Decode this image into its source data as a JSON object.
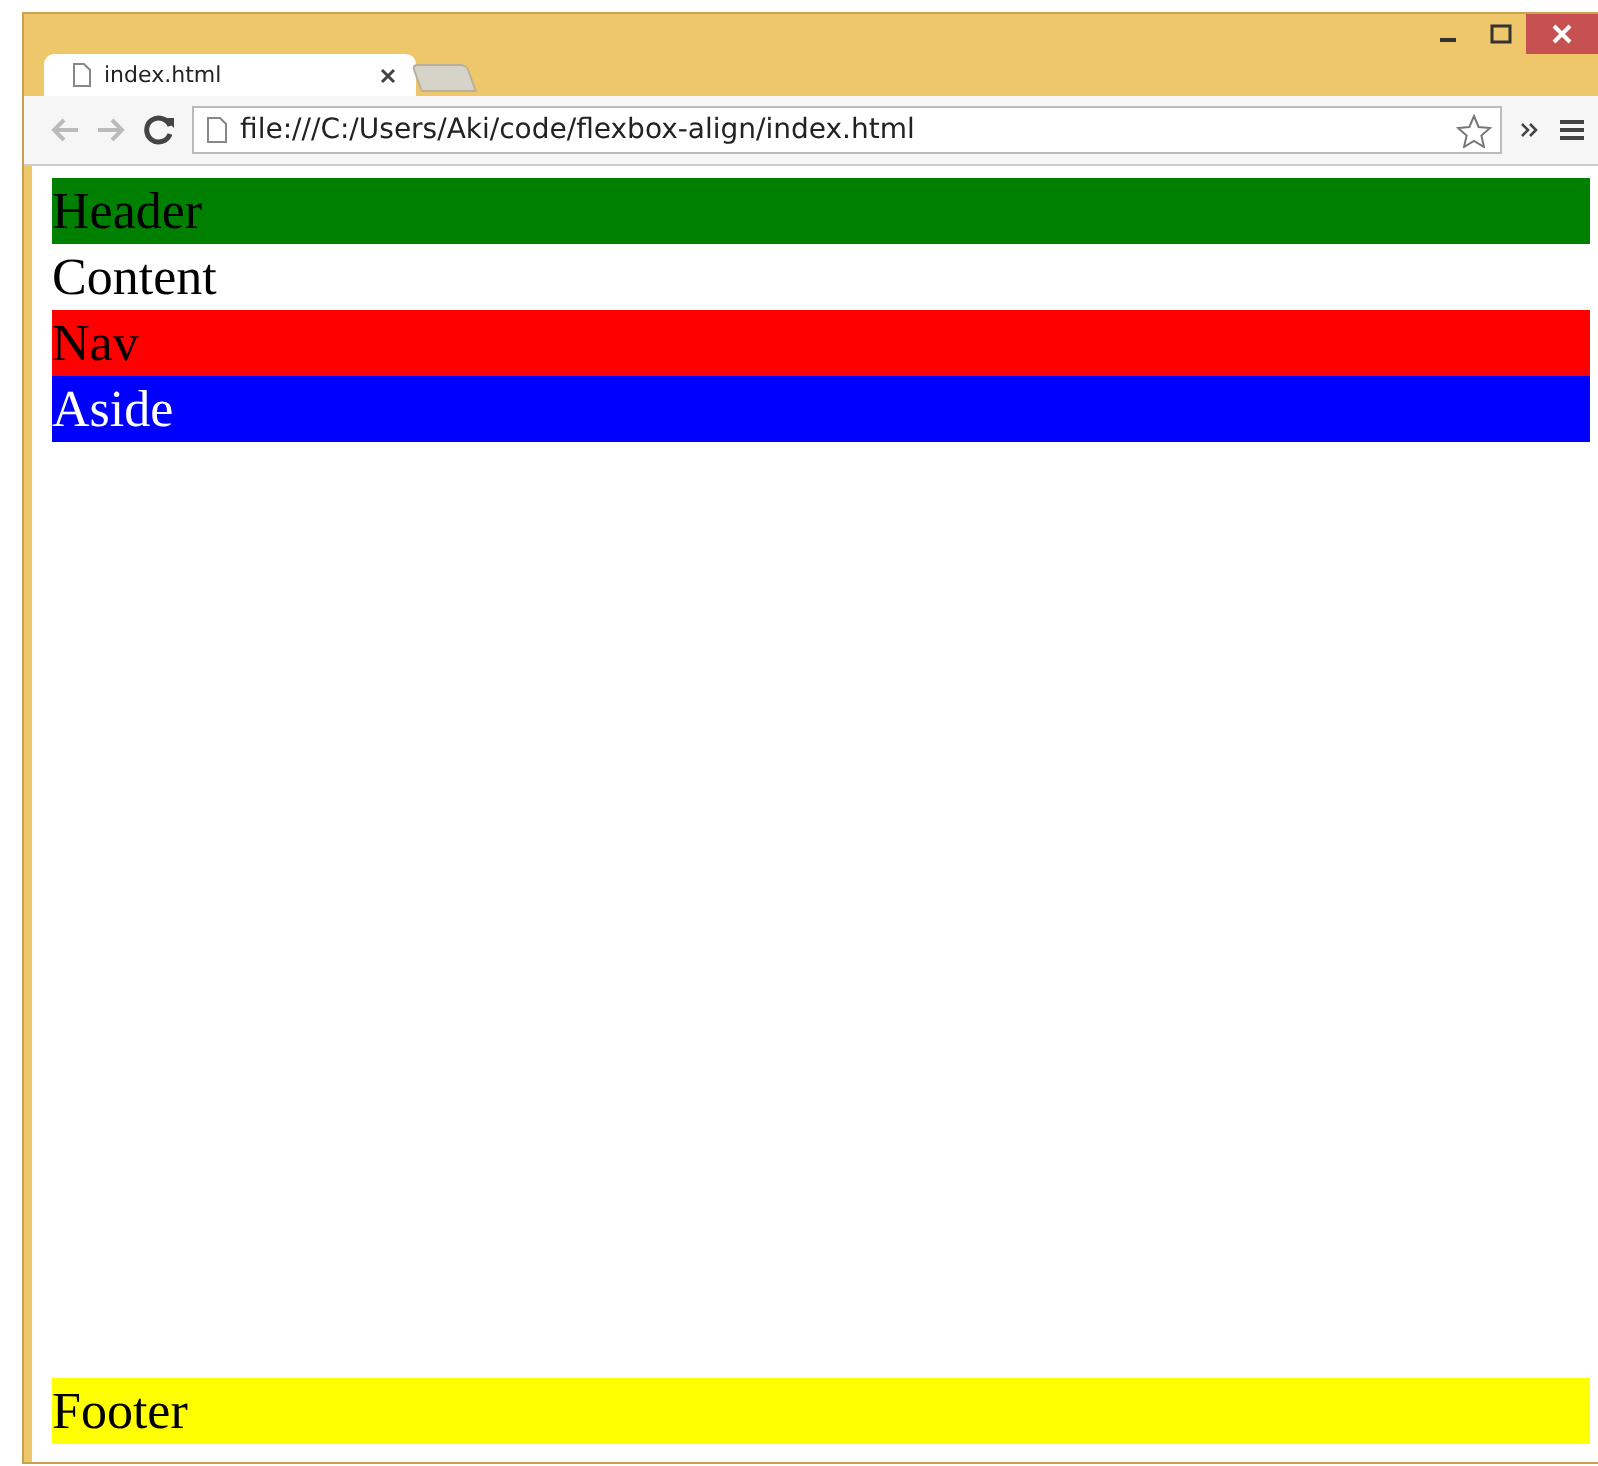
{
  "tab": {
    "title": "index.html",
    "selected": true
  },
  "address_bar": {
    "value": "file:///C:/Users/Aki/code/flexbox-align/index.html"
  },
  "page": [
    {
      "kind": "block",
      "label": "Header",
      "color": "#008000"
    },
    {
      "kind": "block",
      "label": "Content",
      "color": "#ffffff"
    },
    {
      "kind": "block",
      "label": "Nav",
      "color": "#ff0000"
    },
    {
      "kind": "block",
      "label": "Aside",
      "color": "#0000ff"
    },
    {
      "kind": "footer",
      "label": "Footer",
      "color": "#ffff00"
    }
  ]
}
